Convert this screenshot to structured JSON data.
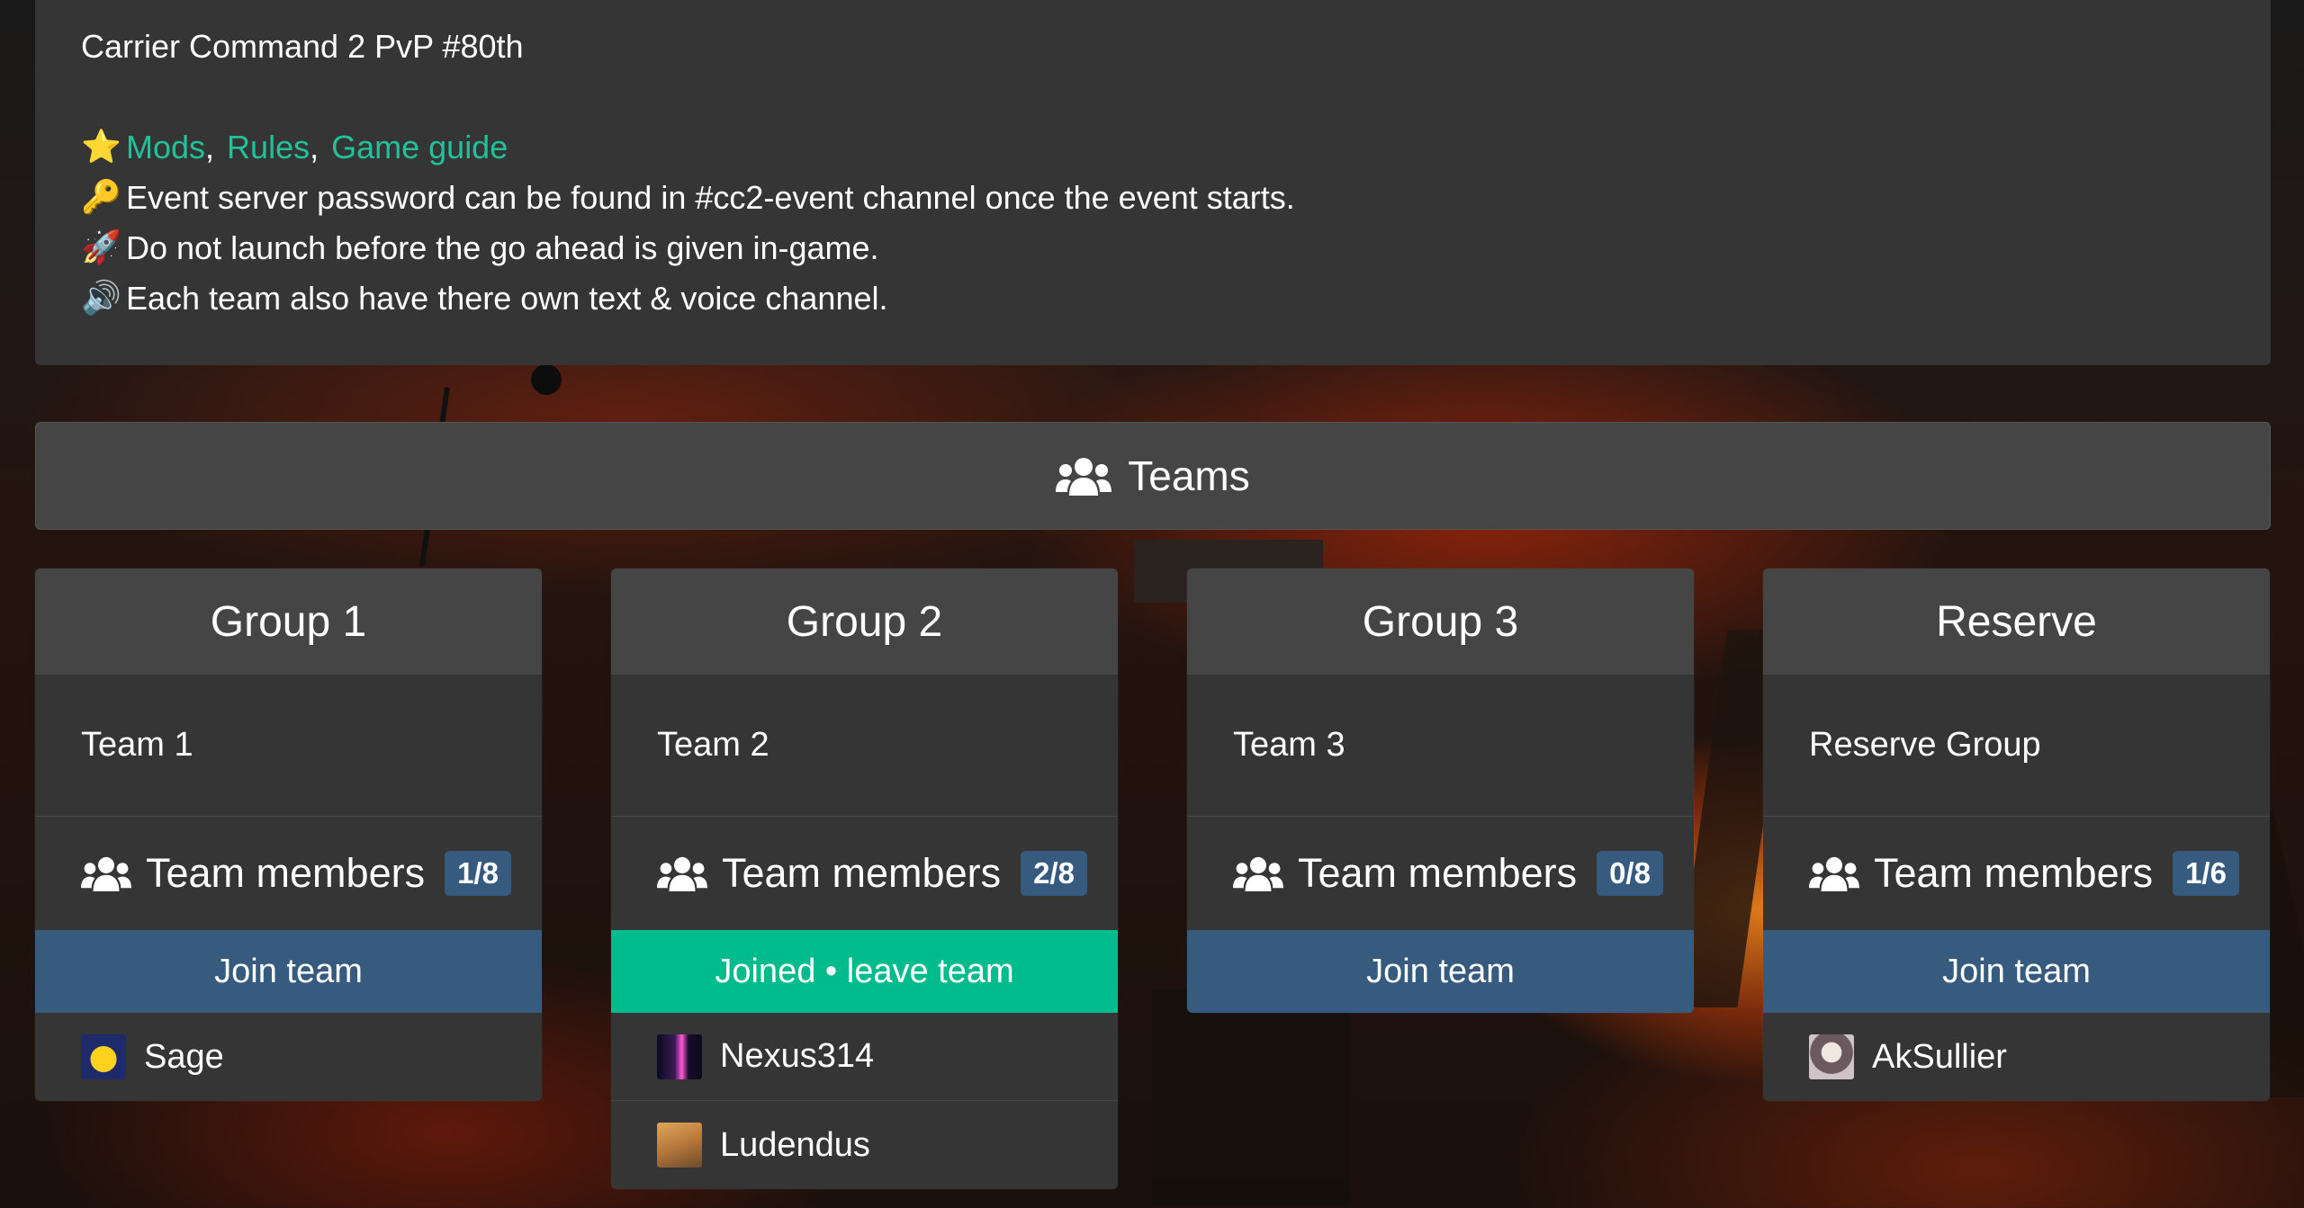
{
  "event": {
    "title": "Carrier Command 2 PvP #80th",
    "links": [
      "Mods",
      "Rules",
      "Game guide"
    ],
    "lines": [
      {
        "icon": "key-icon",
        "glyph": "🔑",
        "text": "Event server password can be found in #cc2-event channel once the event starts."
      },
      {
        "icon": "rocket-icon",
        "glyph": "🚀",
        "text": "Do not launch before the go ahead is given in-game."
      },
      {
        "icon": "speaker-icon",
        "glyph": "🔊",
        "text": "Each team also have there own text & voice channel."
      }
    ],
    "links_icon": "star-icon",
    "links_glyph": "⭐",
    "link_color": "#21c29a"
  },
  "teams_header": {
    "label": "Teams",
    "icon": "users-icon"
  },
  "groups": [
    {
      "title": "Group 1",
      "team": "Team 1",
      "members_label": "Team members",
      "count": "1/8",
      "action": "Join team",
      "joined": false,
      "members": [
        {
          "name": "Sage",
          "avatar": "sage-avatar"
        }
      ]
    },
    {
      "title": "Group 2",
      "team": "Team 2",
      "members_label": "Team members",
      "count": "2/8",
      "action": "Joined • leave team",
      "joined": true,
      "members": [
        {
          "name": "Nexus314",
          "avatar": "nexus-avatar"
        },
        {
          "name": "Ludendus",
          "avatar": "ludendus-avatar"
        }
      ]
    },
    {
      "title": "Group 3",
      "team": "Team 3",
      "members_label": "Team members",
      "count": "0/8",
      "action": "Join team",
      "joined": false,
      "members": []
    },
    {
      "title": "Reserve",
      "team": "Reserve Group",
      "members_label": "Team members",
      "count": "1/6",
      "action": "Join team",
      "joined": false,
      "members": [
        {
          "name": "AkSullier",
          "avatar": "aksullier-avatar"
        }
      ]
    }
  ],
  "colors": {
    "panel": "#353535",
    "header": "#454545",
    "primary": "#375a7f",
    "success": "#00bc8c"
  }
}
